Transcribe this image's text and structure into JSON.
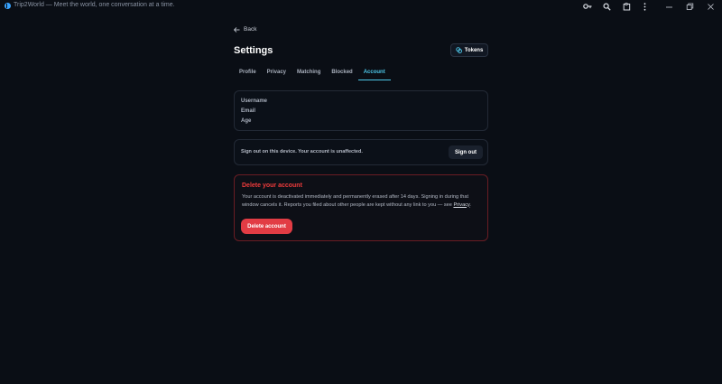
{
  "window": {
    "title": "Trip2World — Meet the world, one conversation at a time.",
    "icons": [
      "key-icon",
      "zoom-icon",
      "extension-icon",
      "more-vertical-icon",
      "minimize-icon",
      "restore-icon",
      "close-icon"
    ]
  },
  "nav": {
    "back_label": "Back"
  },
  "header": {
    "title": "Settings",
    "tokens_label": "Tokens"
  },
  "tabs": [
    {
      "label": "Profile",
      "active": false
    },
    {
      "label": "Privacy",
      "active": false
    },
    {
      "label": "Matching",
      "active": false
    },
    {
      "label": "Blocked",
      "active": false
    },
    {
      "label": "Account",
      "active": true
    }
  ],
  "account_info": {
    "username_label": "Username",
    "email_label": "Email",
    "age_label": "Age"
  },
  "signout": {
    "text": "Sign out on this device. Your account is unaffected.",
    "button_label": "Sign out"
  },
  "danger": {
    "title": "Delete your account",
    "description": "Your account is deactivated immediately and permanently erased after 14 days. Signing in during that window cancels it. Reports you filed about other people are kept without any link to you — see ",
    "link_text": "Privacy",
    "description_end": ".",
    "button_label": "Delete account"
  },
  "colors": {
    "background": "#0a0e15",
    "accent": "#4cc6e8",
    "danger": "#e23c44"
  }
}
